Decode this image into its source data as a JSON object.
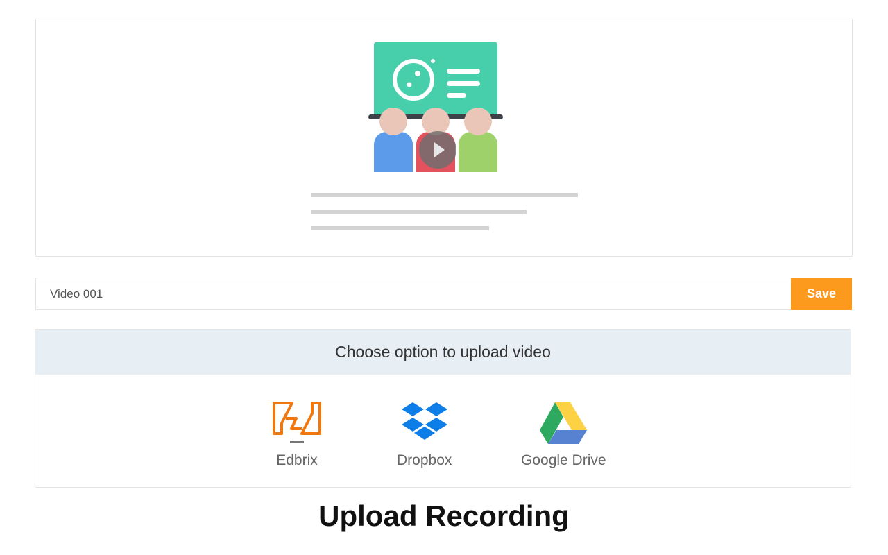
{
  "video_name": {
    "value": "Video 001",
    "save_label": "Save"
  },
  "upload": {
    "header": "Choose option to upload video",
    "options": [
      {
        "label": "Edbrix",
        "icon": "edbrix-icon"
      },
      {
        "label": "Dropbox",
        "icon": "dropbox-icon"
      },
      {
        "label": "Google Drive",
        "icon": "google-drive-icon"
      }
    ]
  },
  "page_title": "Upload Recording",
  "colors": {
    "accent": "#fb9a1d",
    "header_bg": "#e7eef4",
    "board": "#47cfab",
    "edbrix": "#f0780f",
    "dropbox": "#0d7ee8"
  }
}
